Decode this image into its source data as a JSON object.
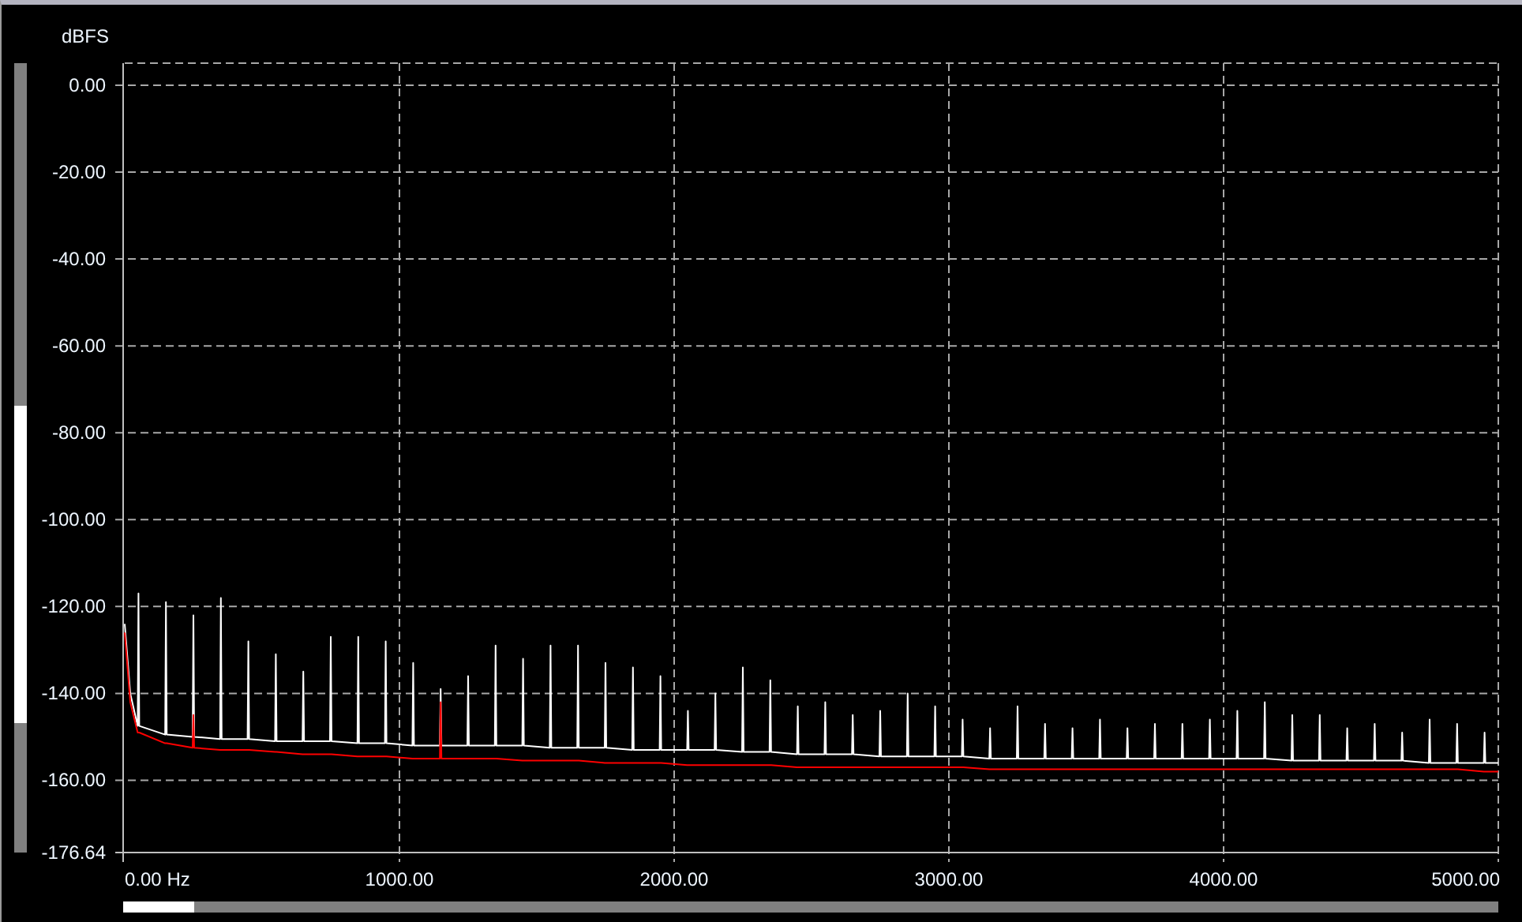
{
  "spectrum": {
    "chart_data": {
      "type": "line",
      "ylabel": "dBFS",
      "grid": true,
      "xlim": [
        0,
        5000
      ],
      "ylim": [
        -176.64,
        5.09
      ],
      "yticks": [
        {
          "value": 0,
          "label": "0.00"
        },
        {
          "value": -20,
          "label": "-20.00"
        },
        {
          "value": -40,
          "label": "-40.00"
        },
        {
          "value": -60,
          "label": "-60.00"
        },
        {
          "value": -80,
          "label": "-80.00"
        },
        {
          "value": -100,
          "label": "-100.00"
        },
        {
          "value": -120,
          "label": "-120.00"
        },
        {
          "value": -140,
          "label": "-140.00"
        },
        {
          "value": -160,
          "label": "-160.00"
        },
        {
          "value": -176.64,
          "label": "-176.64"
        }
      ],
      "xticks": [
        {
          "value": 0,
          "label": "0.00 Hz"
        },
        {
          "value": 1000,
          "label": "1000.00"
        },
        {
          "value": 2000,
          "label": "2000.00"
        },
        {
          "value": 3000,
          "label": "3000.00"
        },
        {
          "value": 4000,
          "label": "4000.00"
        },
        {
          "value": 5000,
          "label": "5000.00"
        }
      ],
      "x": [
        0,
        20,
        47,
        50,
        53,
        147,
        150,
        153,
        247,
        250,
        253,
        347,
        350,
        353,
        447,
        450,
        453,
        547,
        550,
        553,
        647,
        650,
        653,
        747,
        750,
        753,
        847,
        850,
        853,
        947,
        950,
        953,
        1047,
        1050,
        1053,
        1147,
        1150,
        1153,
        1247,
        1250,
        1253,
        1347,
        1350,
        1353,
        1447,
        1450,
        1453,
        1547,
        1550,
        1553,
        1647,
        1650,
        1653,
        1747,
        1750,
        1753,
        1847,
        1850,
        1853,
        1947,
        1950,
        1953,
        2047,
        2050,
        2053,
        2147,
        2150,
        2153,
        2247,
        2250,
        2253,
        2347,
        2350,
        2353,
        2447,
        2450,
        2453,
        2547,
        2550,
        2553,
        2647,
        2650,
        2653,
        2747,
        2750,
        2753,
        2847,
        2850,
        2853,
        2947,
        2950,
        2953,
        3047,
        3050,
        3053,
        3147,
        3150,
        3153,
        3247,
        3250,
        3253,
        3347,
        3350,
        3353,
        3447,
        3450,
        3453,
        3547,
        3550,
        3553,
        3647,
        3650,
        3653,
        3747,
        3750,
        3753,
        3847,
        3850,
        3853,
        3947,
        3950,
        3953,
        4047,
        4050,
        4053,
        4147,
        4150,
        4153,
        4247,
        4250,
        4253,
        4347,
        4350,
        4353,
        4447,
        4450,
        4453,
        4547,
        4550,
        4553,
        4647,
        4650,
        4653,
        4747,
        4750,
        4753,
        4847,
        4850,
        4853,
        4947,
        4950,
        4953,
        5000
      ],
      "series": [
        {
          "color": "#ffffff",
          "values": [
            -124,
            -140,
            -147.5,
            -117,
            -147.5,
            -149.5,
            -119,
            -149.5,
            -150,
            -122,
            -150,
            -150.5,
            -118,
            -150.5,
            -150.5,
            -128,
            -150.5,
            -151,
            -131,
            -151,
            -151,
            -135,
            -151,
            -151,
            -127,
            -151,
            -151.5,
            -127,
            -151.5,
            -151.5,
            -128,
            -151.5,
            -152,
            -133,
            -152,
            -152,
            -139,
            -152,
            -152,
            -136,
            -152,
            -152,
            -129,
            -152,
            -152,
            -132,
            -152,
            -152.5,
            -129,
            -152.5,
            -152.5,
            -129,
            -152.5,
            -152.5,
            -133,
            -152.5,
            -153,
            -134,
            -153,
            -153,
            -136,
            -153,
            -153,
            -144,
            -153,
            -153,
            -140,
            -153,
            -153.5,
            -134,
            -153.5,
            -153.5,
            -137,
            -153.5,
            -154,
            -143,
            -154,
            -154,
            -142,
            -154,
            -154,
            -145,
            -154,
            -154.5,
            -144,
            -154.5,
            -154.5,
            -140,
            -154.5,
            -154.5,
            -143,
            -154.5,
            -154.5,
            -146,
            -154.5,
            -155,
            -148,
            -155,
            -155,
            -143,
            -155,
            -155,
            -147,
            -155,
            -155,
            -148,
            -155,
            -155,
            -146,
            -155,
            -155,
            -148,
            -155,
            -155,
            -147,
            -155,
            -155,
            -147,
            -155,
            -155,
            -146,
            -155,
            -155,
            -144,
            -155,
            -155,
            -142,
            -155,
            -155.5,
            -145,
            -155.5,
            -155.5,
            -145,
            -155.5,
            -155.5,
            -148,
            -155.5,
            -155.5,
            -147,
            -155.5,
            -155.5,
            -149,
            -155.5,
            -156,
            -146,
            -156,
            -156,
            -147,
            -156,
            -156,
            -149,
            -156,
            -156
          ]
        },
        {
          "color": "#ff0000",
          "values": [
            -126,
            -142,
            -149,
            -149,
            -149,
            -151.5,
            -151.5,
            -151.5,
            -152.5,
            -145,
            -152.5,
            -153,
            -153,
            -153,
            -153,
            -153,
            -153,
            -153.5,
            -153.5,
            -153.5,
            -154,
            -154,
            -154,
            -154,
            -154,
            -154,
            -154.5,
            -154.5,
            -154.5,
            -154.5,
            -154.5,
            -154.5,
            -155,
            -155,
            -155,
            -155,
            -142,
            -155,
            -155,
            -155,
            -155,
            -155,
            -155,
            -155,
            -155.5,
            -155.5,
            -155.5,
            -155.5,
            -155.5,
            -155.5,
            -155.5,
            -155.5,
            -155.5,
            -156,
            -156,
            -156,
            -156,
            -156,
            -156,
            -156,
            -156,
            -156,
            -156.5,
            -156.5,
            -156.5,
            -156.5,
            -156.5,
            -156.5,
            -156.5,
            -156.5,
            -156.5,
            -156.5,
            -156.5,
            -156.5,
            -157,
            -157,
            -157,
            -157,
            -157,
            -157,
            -157,
            -157,
            -157,
            -157,
            -157,
            -157,
            -157,
            -157,
            -157,
            -157,
            -157,
            -157,
            -157,
            -157,
            -157,
            -157.5,
            -157.5,
            -157.5,
            -157.5,
            -157.5,
            -157.5,
            -157.5,
            -157.5,
            -157.5,
            -157.5,
            -157.5,
            -157.5,
            -157.5,
            -157.5,
            -157.5,
            -157.5,
            -157.5,
            -157.5,
            -157.5,
            -157.5,
            -157.5,
            -157.5,
            -157.5,
            -157.5,
            -157.5,
            -157.5,
            -157.5,
            -157.5,
            -157.5,
            -157.5,
            -157.5,
            -157.5,
            -157.5,
            -157.5,
            -157.5,
            -157.5,
            -157.5,
            -157.5,
            -157.5,
            -157.5,
            -157.5,
            -157.5,
            -157.5,
            -157.5,
            -157.5,
            -157.5,
            -157.5,
            -157.5,
            -157.5,
            -157.5,
            -157.5,
            -157.5,
            -157.5,
            -157.5,
            -158,
            -158,
            -158,
            -158
          ]
        }
      ]
    }
  }
}
